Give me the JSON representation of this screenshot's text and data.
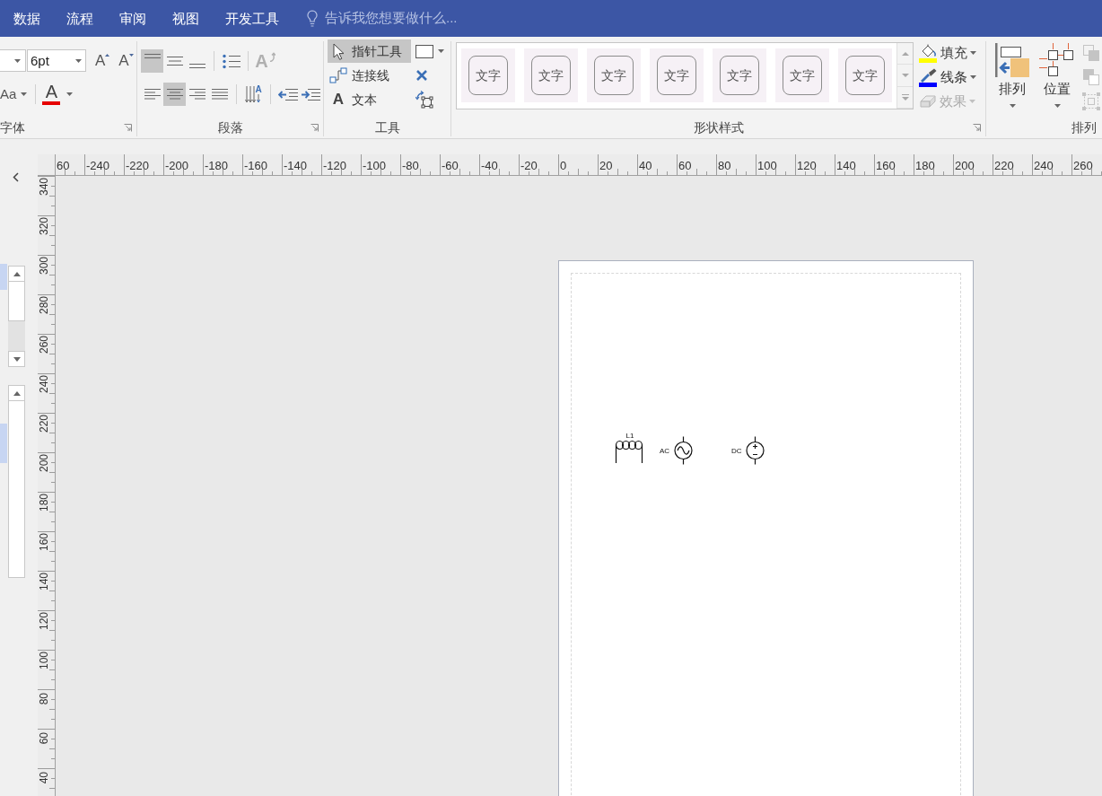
{
  "menu_tabs": [
    {
      "label": "数据",
      "selected": false
    },
    {
      "label": "流程",
      "selected": false
    },
    {
      "label": "审阅",
      "selected": false
    },
    {
      "label": "视图",
      "selected": false
    },
    {
      "label": "开发工具",
      "selected": false
    }
  ],
  "tell_me": {
    "placeholder": "告诉我您想要做什么..."
  },
  "ribbon": {
    "font": {
      "label": "字体",
      "size": "6pt",
      "grow_glyph": "A",
      "shrink_glyph": "A",
      "case_label": "Aa",
      "color_glyph": "A"
    },
    "paragraph": {
      "label": "段落",
      "vertical_align": [
        {
          "kind": "top",
          "selected": true
        },
        {
          "kind": "middle",
          "selected": false
        },
        {
          "kind": "bottom",
          "selected": false
        }
      ],
      "text_block": {
        "glyph": "A",
        "disabled": true
      },
      "horizontal_align": [
        {
          "kind": "left",
          "selected": false
        },
        {
          "kind": "center",
          "selected": true
        },
        {
          "kind": "right",
          "selected": false
        },
        {
          "kind": "justify",
          "selected": false
        }
      ],
      "text_direction_glyph": "A"
    },
    "tools": {
      "label": "工具",
      "items": [
        {
          "kind": "pointer",
          "label": "指针工具",
          "selected": true
        },
        {
          "kind": "connector",
          "label": "连接线",
          "selected": false
        },
        {
          "kind": "text",
          "label": "文本",
          "glyph": "A",
          "selected": false
        }
      ]
    },
    "shape_styles": {
      "label": "形状样式",
      "gallery": [
        {
          "text": "文字",
          "selected": false
        },
        {
          "text": "文字",
          "selected": false
        },
        {
          "text": "文字",
          "selected": false
        },
        {
          "text": "文字",
          "selected": false
        },
        {
          "text": "文字",
          "selected": false
        },
        {
          "text": "文字",
          "selected": false
        },
        {
          "text": "文字",
          "selected": false
        }
      ],
      "format_buttons": [
        {
          "kind": "fill",
          "label": "填充",
          "disabled": false
        },
        {
          "kind": "line",
          "label": "线条",
          "disabled": false
        },
        {
          "kind": "effects",
          "label": "效果",
          "disabled": true
        }
      ]
    },
    "arrange": {
      "label": "排列",
      "big_buttons": [
        {
          "kind": "arrange",
          "label": "排列"
        },
        {
          "kind": "position",
          "label": "位置"
        }
      ],
      "small_tools": [
        {
          "kind": "bring_forward",
          "disabled": true
        },
        {
          "kind": "send_backward",
          "disabled": true
        },
        {
          "kind": "group",
          "disabled": true
        }
      ]
    }
  },
  "rulers": {
    "horizontal": [
      "60",
      "-240",
      "-220",
      "-200",
      "-180",
      "-160",
      "-140",
      "-120",
      "-100",
      "-80",
      "-60",
      "-40",
      "-20",
      "0",
      "20",
      "40",
      "60",
      "80",
      "100",
      "120",
      "140",
      "160",
      "180",
      "200",
      "220",
      "240",
      "260"
    ],
    "vertical": [
      "340",
      "320",
      "300",
      "280",
      "260",
      "240",
      "220",
      "200",
      "180",
      "160",
      "140",
      "120",
      "100",
      "80",
      "60",
      "40"
    ]
  },
  "drawing": {
    "shapes": [
      {
        "kind": "inductor",
        "label": "L1"
      },
      {
        "kind": "ac_source",
        "label": "AC"
      },
      {
        "kind": "dc_source",
        "label": "DC"
      }
    ]
  }
}
